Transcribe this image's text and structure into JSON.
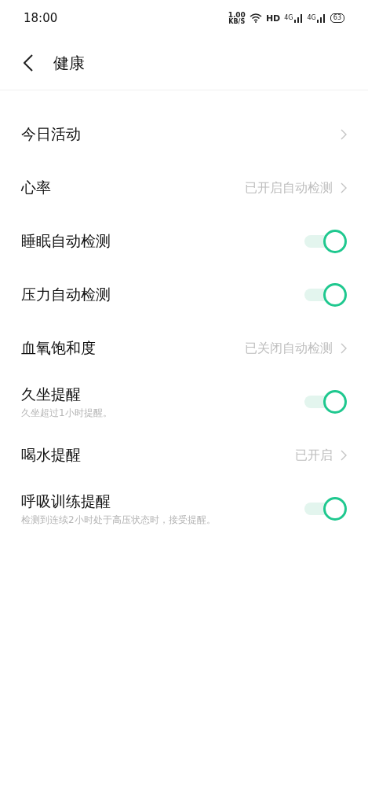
{
  "status_bar": {
    "time": "18:00",
    "speed": "1.00",
    "speed_unit": "KB/S",
    "hd": "HD",
    "networks": [
      "4G",
      "4G"
    ],
    "battery": "63"
  },
  "header": {
    "title": "健康"
  },
  "rows": [
    {
      "kind": "link",
      "label": "今日活动"
    },
    {
      "kind": "link",
      "label": "心率",
      "value": "已开启自动检测"
    },
    {
      "kind": "toggle",
      "label": "睡眠自动检测",
      "on": true
    },
    {
      "kind": "toggle",
      "label": "压力自动检测",
      "on": true
    },
    {
      "kind": "link",
      "label": "血氧饱和度",
      "value": "已关闭自动检测"
    },
    {
      "kind": "toggle",
      "label": "久坐提醒",
      "subtitle": "久坐超过1小时提醒。",
      "on": true
    },
    {
      "kind": "link",
      "label": "喝水提醒",
      "value": "已开启"
    },
    {
      "kind": "toggle",
      "label": "呼吸训练提醒",
      "subtitle": "检测到连续2小时处于高压状态时，接受提醒。",
      "on": true
    }
  ]
}
